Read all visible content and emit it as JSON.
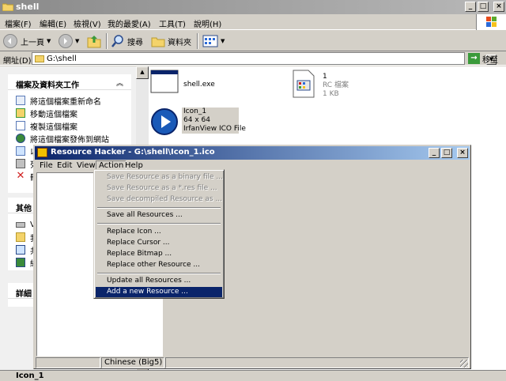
{
  "explorer": {
    "title": "shell",
    "menu": [
      "檔案(F)",
      "編輯(E)",
      "檢視(V)",
      "我的最愛(A)",
      "工具(T)",
      "說明(H)"
    ],
    "toolbar": {
      "back": "上一頁",
      "search": "搜尋",
      "folders": "資料夾"
    },
    "address": {
      "label": "網址(D)",
      "path": "G:\\shell",
      "go": "移至"
    },
    "tasks_panel": {
      "title": "檔案及資料夾工作",
      "items": [
        "將這個檔案重新命名",
        "移動這個檔案",
        "複製這個檔案",
        "將這個檔案發佈到網站",
        "以",
        "列",
        "刪"
      ]
    },
    "other_panel": {
      "title": "其他",
      "items": [
        "V",
        "我",
        "共",
        "網"
      ]
    },
    "details_panel": {
      "title": "詳細"
    },
    "files": [
      {
        "name": "shell.exe"
      },
      {
        "name": "1",
        "type": "RC 檔案",
        "size": "1 KB"
      },
      {
        "name": "Icon_1",
        "dims": "64 x 64",
        "type": "IrfanView ICO File"
      }
    ],
    "status": "Icon_1"
  },
  "rh": {
    "title": "Resource Hacker  -  G:\\shell\\Icon_1.ico",
    "menu": [
      "File",
      "Edit",
      "View",
      "Action",
      "Help"
    ],
    "status_lang": "Chinese (Big5)",
    "action_menu": [
      {
        "label": "Save Resource as a binary file ...",
        "disabled": true
      },
      {
        "label": "Save Resource as a *.res file ...",
        "disabled": true
      },
      {
        "label": "Save decompiled Resource as ...",
        "disabled": true
      },
      {
        "label": "Save all Resources ...",
        "disabled": false
      },
      {
        "label": "Replace Icon ...",
        "disabled": false
      },
      {
        "label": "Replace Cursor ...",
        "disabled": false
      },
      {
        "label": "Replace Bitmap ...",
        "disabled": false
      },
      {
        "label": "Replace other Resource ...",
        "disabled": false
      },
      {
        "label": "Update all Resources ...",
        "disabled": false
      },
      {
        "label": "Add a new Resource ...",
        "disabled": false,
        "highlighted": true
      }
    ]
  },
  "colors": {
    "rh_title": "#0a246a",
    "highlight": "#0a246a",
    "face": "#d4d0c8"
  }
}
